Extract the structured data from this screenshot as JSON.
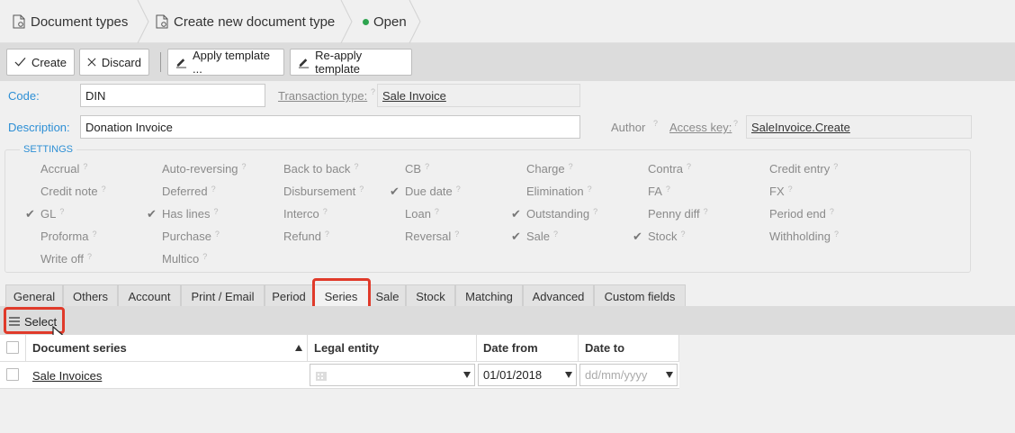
{
  "breadcrumb": {
    "items": [
      "Document types",
      "Create new document type"
    ],
    "status": "Open"
  },
  "toolbar": {
    "create_label": "Create",
    "discard_label": "Discard",
    "apply_template_label": "Apply template ...",
    "reapply_template_label": "Re-apply template"
  },
  "form": {
    "code_label": "Code:",
    "code_value": "DIN",
    "transaction_type_label": "Transaction type:",
    "transaction_type_value": "Sale Invoice",
    "description_label": "Description:",
    "description_value": "Donation Invoice",
    "author_label": "Author",
    "access_key_label": "Access key:",
    "access_key_value": "SaleInvoice.Create"
  },
  "settings": {
    "title": "SETTINGS",
    "options": [
      {
        "label": "Accrual",
        "checked": false
      },
      {
        "label": "Auto-reversing",
        "checked": false
      },
      {
        "label": "Back to back",
        "checked": false
      },
      {
        "label": "CB",
        "checked": false
      },
      {
        "label": "Charge",
        "checked": false
      },
      {
        "label": "Contra",
        "checked": false
      },
      {
        "label": "Credit entry",
        "checked": false
      },
      {
        "label": "Credit note",
        "checked": false
      },
      {
        "label": "Deferred",
        "checked": false
      },
      {
        "label": "Disbursement",
        "checked": false
      },
      {
        "label": "Due date",
        "checked": true
      },
      {
        "label": "Elimination",
        "checked": false
      },
      {
        "label": "FA",
        "checked": false
      },
      {
        "label": "FX",
        "checked": false
      },
      {
        "label": "GL",
        "checked": true
      },
      {
        "label": "Has lines",
        "checked": true
      },
      {
        "label": "Interco",
        "checked": false
      },
      {
        "label": "Loan",
        "checked": false
      },
      {
        "label": "Outstanding",
        "checked": true
      },
      {
        "label": "Penny diff",
        "checked": false
      },
      {
        "label": "Period end",
        "checked": false
      },
      {
        "label": "Proforma",
        "checked": false
      },
      {
        "label": "Purchase",
        "checked": false
      },
      {
        "label": "Refund",
        "checked": false
      },
      {
        "label": "Reversal",
        "checked": false
      },
      {
        "label": "Sale",
        "checked": true
      },
      {
        "label": "Stock",
        "checked": true
      },
      {
        "label": "Withholding",
        "checked": false
      },
      {
        "label": "Write off",
        "checked": false
      },
      {
        "label": "Multico",
        "checked": false
      }
    ]
  },
  "tabs": [
    "General",
    "Others",
    "Account",
    "Print / Email",
    "Period",
    "Series",
    "Sale",
    "Stock",
    "Matching",
    "Advanced",
    "Custom fields"
  ],
  "active_tab": "Series",
  "grid": {
    "select_label": "Select",
    "columns": [
      "Document series",
      "Legal entity",
      "Date from",
      "Date to"
    ],
    "rows": [
      {
        "document_series": "Sale Invoices",
        "legal_entity": "",
        "date_from": "01/01/2018",
        "date_to_placeholder": "dd/mm/yyyy"
      }
    ]
  },
  "colors": {
    "accent": "#2d8fd5",
    "highlight": "#e03a2a",
    "status_open": "#2ea44f"
  }
}
